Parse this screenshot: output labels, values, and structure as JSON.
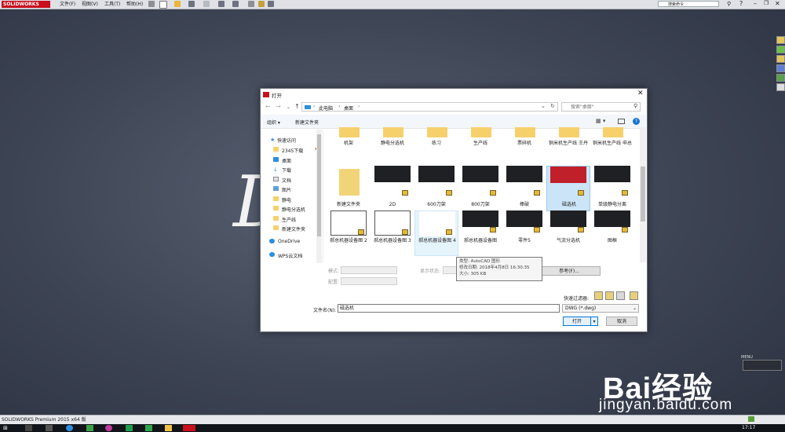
{
  "app": {
    "logo_text": "SOLIDWORKS",
    "menus": [
      "文件(F)",
      "视图(V)",
      "工具(T)",
      "帮助(H)"
    ],
    "search_placeholder": "搜索命令",
    "status_text": "SOLIDWORKS Premium 2015 x64 版",
    "menu_corner": "MENU",
    "clock": "17:17",
    "background_text": "DS"
  },
  "dialog": {
    "title": "打开",
    "address": [
      "此电脑",
      "桌面"
    ],
    "search_placeholder": "搜索\"桌面\"",
    "organize": "组织 ▾",
    "new_folder": "新建文件夹",
    "nav": [
      "快速访问",
      "2345下载",
      "桌面",
      "下载",
      "文档",
      "图片",
      "静电",
      "静电分选机",
      "生产线",
      "新建文件夹",
      "OneDrive",
      "WPS云文档"
    ],
    "files": [
      "机架",
      "静电分选机",
      "练习",
      "生产线",
      "票碎机",
      "铜米机生产线 王丹",
      "铜米机生产线 申总",
      "新建文件夹",
      "2D",
      "600刀架",
      "800刀架",
      "棒破",
      "磁选机",
      "单级静电分离",
      "郝总机器设备图 2",
      "郝总机器设备图 3",
      "郝总机器设备图 4",
      "郝总机器设备图",
      "零件5",
      "气流分选机",
      "图框"
    ],
    "form": {
      "mode_label": "模式:",
      "config_label": "配置:",
      "display_label": "显示状态:",
      "reference_btn": "参考(F)...",
      "filter_label": "快速过滤器:",
      "filename_label": "文件名(N):",
      "filename_value": "磁选机",
      "filetype_value": "DWG (*.dwg)",
      "open_btn": "打开",
      "cancel_btn": "取消"
    },
    "tooltip": {
      "type": "类型: AutoCAD 图形",
      "modified": "修改日期: 2018年4月8日 16:30:35",
      "size": "大小: 305 KB"
    }
  },
  "watermark": {
    "brand": "Bai经验",
    "url": "jingyan.baidu.com"
  }
}
